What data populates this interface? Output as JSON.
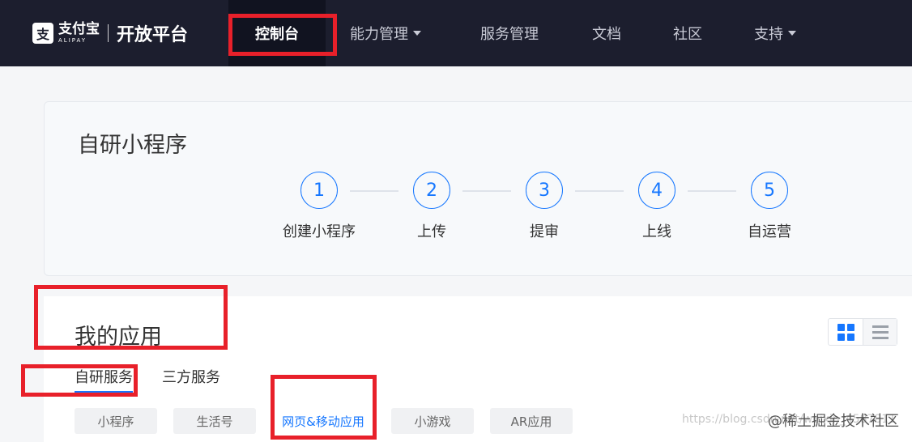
{
  "header": {
    "logo_mark": "支",
    "logo_cn": "支付宝",
    "logo_en": "ALIPAY",
    "title": "开放平台",
    "nav": [
      {
        "label": "控制台"
      },
      {
        "label": "能力管理"
      },
      {
        "label": "服务管理"
      },
      {
        "label": "文档"
      },
      {
        "label": "社区"
      },
      {
        "label": "支持"
      }
    ]
  },
  "steps_card": {
    "title": "自研小程序",
    "steps": [
      {
        "num": "1",
        "label": "创建小程序"
      },
      {
        "num": "2",
        "label": "上传"
      },
      {
        "num": "3",
        "label": "提审"
      },
      {
        "num": "4",
        "label": "上线"
      },
      {
        "num": "5",
        "label": "自运营"
      }
    ]
  },
  "apps": {
    "title": "我的应用",
    "tabs": [
      "自研服务",
      "三方服务"
    ],
    "chips": [
      "小程序",
      "生活号",
      "网页&移动应用",
      "小游戏",
      "AR应用"
    ]
  },
  "watermark": {
    "url": "https://blog.csdn.net/weixin_4587811",
    "text": "@稀土掘金技术社区"
  },
  "colors": {
    "accent": "#1677ff",
    "highlight": "#e8202a",
    "topbar": "#1c1e2e"
  }
}
